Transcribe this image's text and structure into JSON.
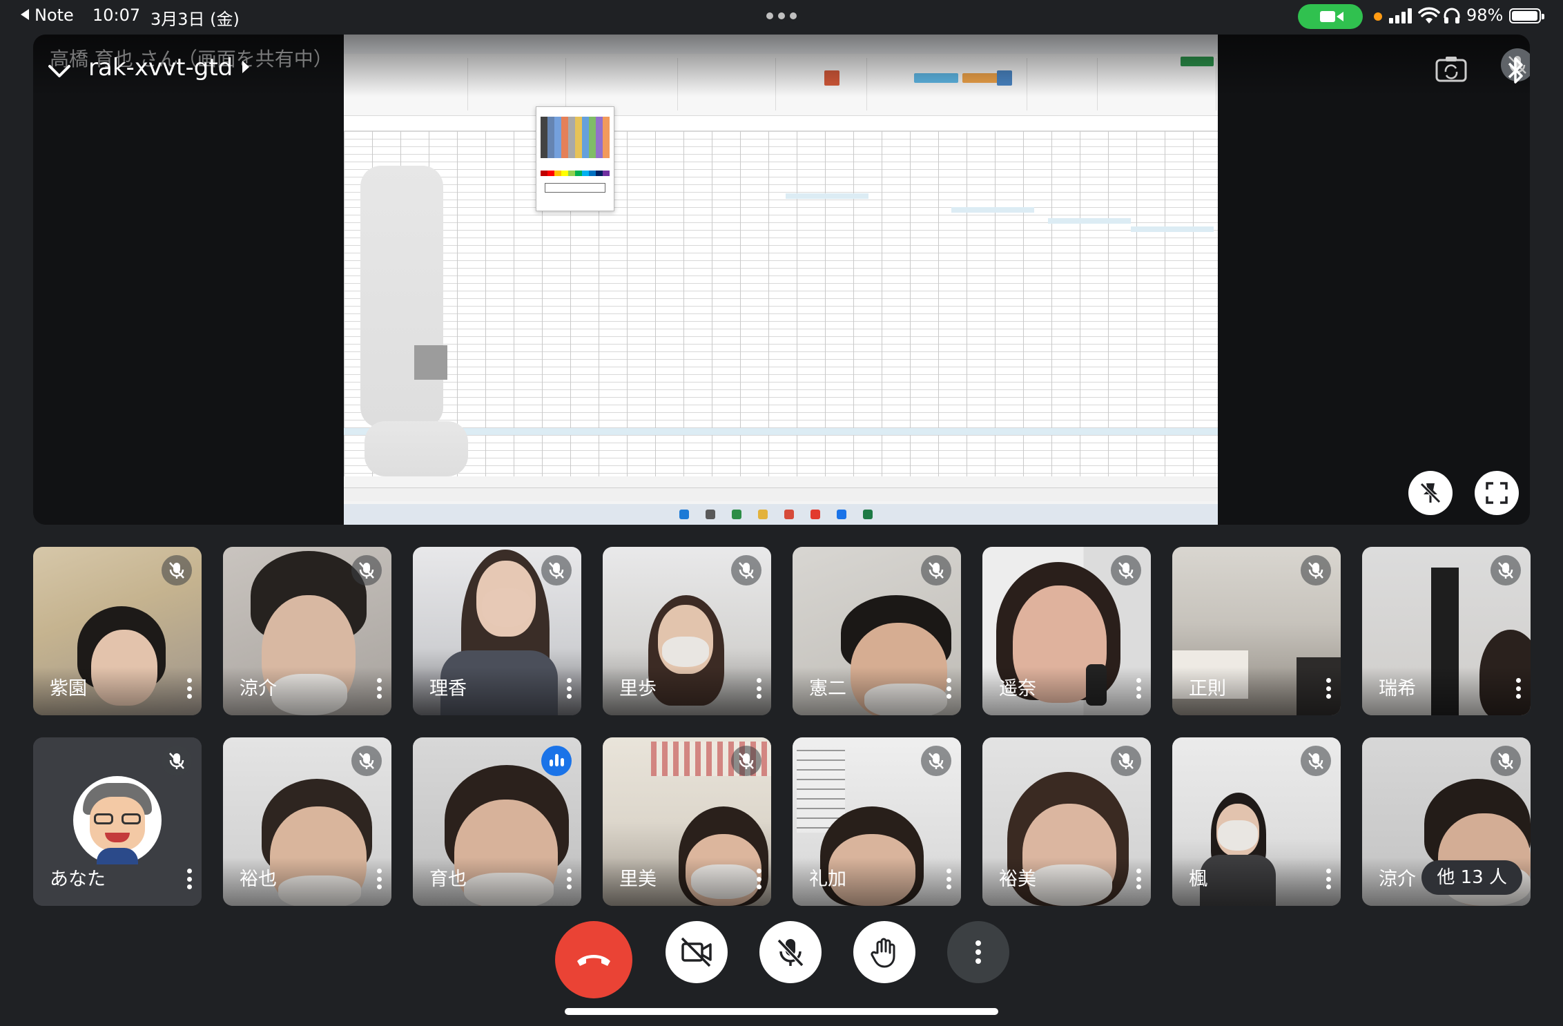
{
  "status_bar": {
    "back_label": "Note",
    "time": "10:07",
    "date": "3月3日 (金)",
    "battery_pct": "98%",
    "battery_level": 0.98
  },
  "stage": {
    "presenter_text": "高橋 育也 さん（画面を共有中）",
    "meeting_code": "rak-xvvt-gtd"
  },
  "participants_row1": [
    {
      "name": "紫園",
      "muted": true
    },
    {
      "name": "涼介",
      "muted": true
    },
    {
      "name": "理香",
      "muted": true
    },
    {
      "name": "里歩",
      "muted": true
    },
    {
      "name": "憲二",
      "muted": true
    },
    {
      "name": "遥奈",
      "muted": true
    },
    {
      "name": "正則",
      "muted": true
    },
    {
      "name": "瑞希",
      "muted": true
    }
  ],
  "participants_row2": [
    {
      "name": "あなた",
      "muted": true
    },
    {
      "name": "裕也",
      "muted": true
    },
    {
      "name": "育也",
      "muted": false,
      "speaking": true
    },
    {
      "name": "里美",
      "muted": true
    },
    {
      "name": "礼加",
      "muted": true
    },
    {
      "name": "裕美",
      "muted": true
    },
    {
      "name": "楓",
      "muted": true
    },
    {
      "name": "涼介",
      "muted": true
    }
  ],
  "others": {
    "label": "他 13 人"
  },
  "controls": {
    "icons": [
      "end-call-icon",
      "camera-off-icon",
      "mic-off-icon",
      "raise-hand-icon",
      "more-vert-icon"
    ]
  },
  "colors": {
    "end_call": "#ea4335",
    "camera_pill": "#30c14f",
    "speaking": "#1a73e8"
  }
}
